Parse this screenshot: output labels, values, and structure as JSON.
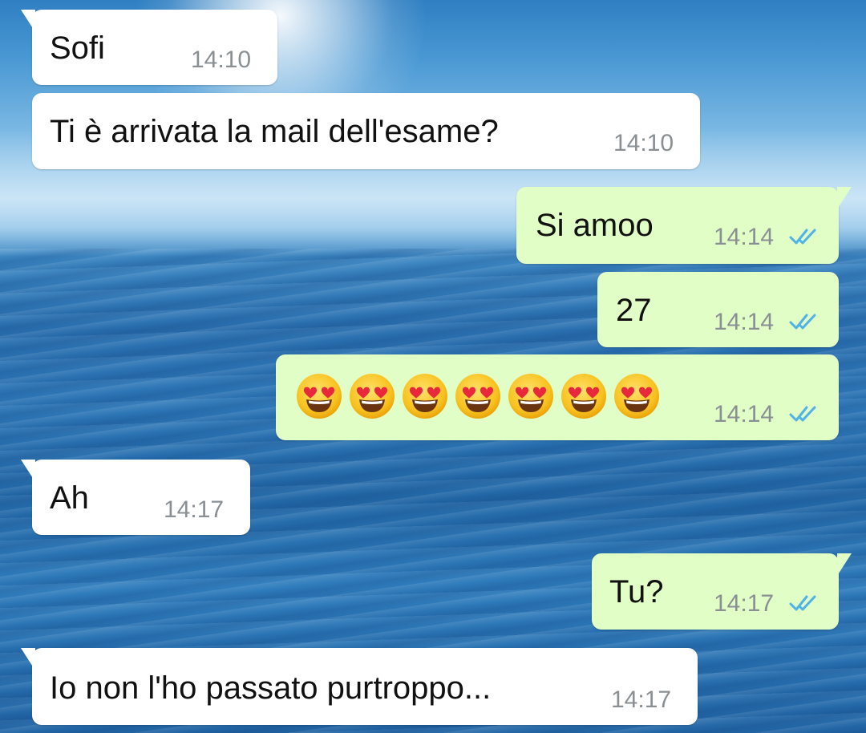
{
  "conversation": {
    "messages": [
      {
        "direction": "incoming",
        "text": "Sofi",
        "time": "14:10"
      },
      {
        "direction": "incoming",
        "text": "Ti è arrivata la mail dell'esame?",
        "time": "14:10"
      },
      {
        "direction": "outgoing",
        "text": "Si amoo",
        "time": "14:14",
        "status": "read"
      },
      {
        "direction": "outgoing",
        "text": "27",
        "time": "14:14",
        "status": "read"
      },
      {
        "direction": "outgoing",
        "emoji": "smiling-face-with-heart-eyes",
        "emoji_count": 7,
        "time": "14:14",
        "status": "read"
      },
      {
        "direction": "incoming",
        "text": "Ah",
        "time": "14:17"
      },
      {
        "direction": "outgoing",
        "text": "Tu?",
        "time": "14:17",
        "status": "read"
      },
      {
        "direction": "incoming",
        "text": "Io non l'ho passato purtroppo...",
        "time": "14:17"
      }
    ]
  },
  "icons": {
    "read_receipt": "double-check-icon",
    "emoji": "smiling-face-with-heart-eyes-icon",
    "read_receipt_color": "#4fb3e8"
  },
  "colors": {
    "incoming_bubble": "#ffffff",
    "outgoing_bubble": "#e1fec6",
    "timestamp": "#8a8f93"
  }
}
